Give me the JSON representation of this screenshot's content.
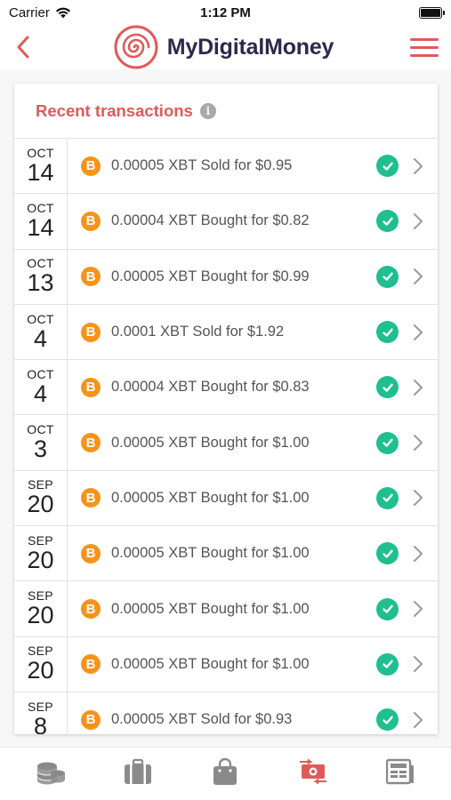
{
  "status_bar": {
    "carrier": "Carrier",
    "time": "1:12 PM"
  },
  "header": {
    "brand_name": "MyDigitalMoney",
    "accent_color": "#e05a5a"
  },
  "card": {
    "title": "Recent transactions",
    "info_glyph": "i",
    "coin_glyph": "B",
    "transactions": [
      {
        "month": "OCT",
        "day": "14",
        "text": "0.00005 XBT Sold for $0.95"
      },
      {
        "month": "OCT",
        "day": "14",
        "text": "0.00004 XBT Bought for $0.82"
      },
      {
        "month": "OCT",
        "day": "13",
        "text": "0.00005 XBT Bought for $0.99"
      },
      {
        "month": "OCT",
        "day": "4",
        "text": "0.0001 XBT Sold for $1.92"
      },
      {
        "month": "OCT",
        "day": "4",
        "text": "0.00004 XBT Bought for $0.83"
      },
      {
        "month": "OCT",
        "day": "3",
        "text": "0.00005 XBT Bought for $1.00"
      },
      {
        "month": "SEP",
        "day": "20",
        "text": "0.00005 XBT Bought for $1.00"
      },
      {
        "month": "SEP",
        "day": "20",
        "text": "0.00005 XBT Bought for $1.00"
      },
      {
        "month": "SEP",
        "day": "20",
        "text": "0.00005 XBT Bought for $1.00"
      },
      {
        "month": "SEP",
        "day": "20",
        "text": "0.00005 XBT Bought for $1.00"
      },
      {
        "month": "SEP",
        "day": "8",
        "text": "0.00005 XBT Sold for $0.93"
      }
    ]
  },
  "tabbar": {
    "tabs": [
      {
        "icon": "coins-icon",
        "active": false
      },
      {
        "icon": "briefcase-icon",
        "active": false
      },
      {
        "icon": "shopping-bag-icon",
        "active": false
      },
      {
        "icon": "exchange-icon",
        "active": true
      },
      {
        "icon": "ledger-icon",
        "active": false
      }
    ],
    "active_color": "#e05a5a",
    "inactive_color": "#8a8a8a"
  }
}
